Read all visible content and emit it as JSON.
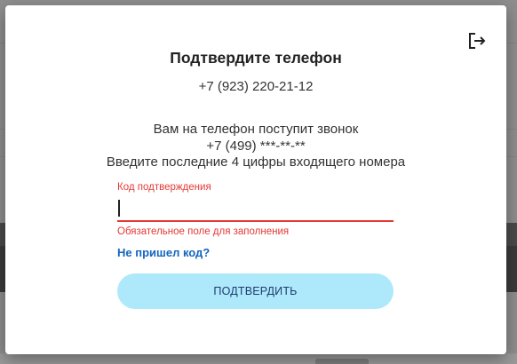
{
  "modal": {
    "title": "Подтвердите телефон",
    "phone": "+7 (923) 220-21-12",
    "instructions": {
      "line1": "Вам на телефон поступит звонок",
      "line2": "+7 (499) ***-**-**",
      "line3": "Введите последние 4 цифры входящего номера"
    },
    "code_field": {
      "label": "Код подтверждения",
      "value": "",
      "error": "Обязательное поле для заполнения"
    },
    "resend_link": "Не пришел код?",
    "confirm_button": "ПОДТВЕРДИТЬ",
    "logout_icon": "logout-icon"
  },
  "colors": {
    "error": "#e53935",
    "link": "#1565c0",
    "button_bg": "#aee9fb",
    "button_text": "#1d3b6e"
  }
}
